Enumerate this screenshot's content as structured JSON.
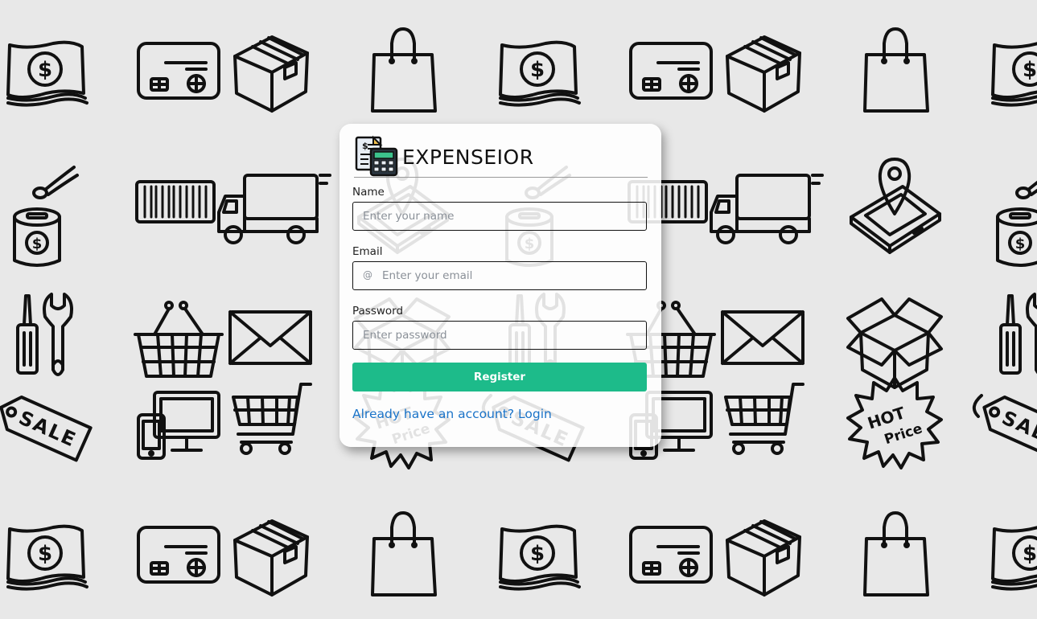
{
  "app": {
    "title": "EXPENSEIOR"
  },
  "form": {
    "name": {
      "label": "Name",
      "placeholder": "Enter your name"
    },
    "email": {
      "label": "Email",
      "icon": "@",
      "placeholder": "Enter your email"
    },
    "password": {
      "label": "Password",
      "placeholder": "Enter password"
    },
    "register_label": "Register",
    "login_link": "Already have an account? Login"
  },
  "background": {
    "sale_tag_text": "SALE",
    "hot_price_line1": "HOT",
    "hot_price_line2": "Price"
  },
  "colors": {
    "accent": "#1dbb8a",
    "link": "#1a73c8",
    "background": "#e8e8e8"
  }
}
